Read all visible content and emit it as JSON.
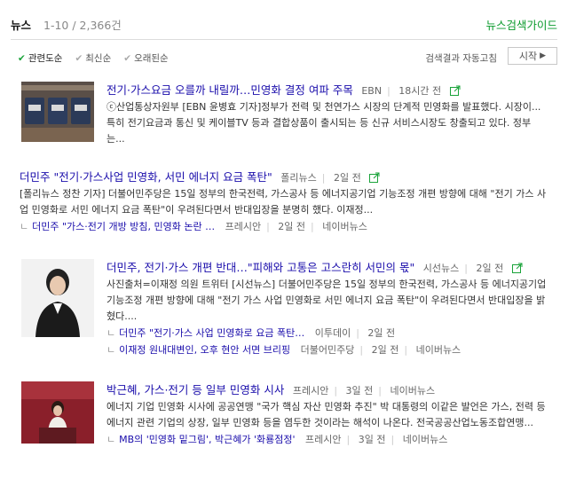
{
  "header": {
    "title": "뉴스",
    "count": "1-10 / 2,366건",
    "guide_link": "뉴스검색가이드"
  },
  "sort": {
    "options": [
      "관련도순",
      "최신순",
      "오래된순"
    ],
    "selected": "관련도순"
  },
  "autorefresh": {
    "label": "검색결과 자동고침",
    "button": "시작"
  },
  "results": [
    {
      "title": "전기·가스요금 오를까 내릴까…민영화 결정 여파 주목",
      "source": "EBN",
      "time": "18시간 전",
      "desc": "ⓒ산업통상자원부 [EBN 윤병효 기자]정부가 전력 및 천연가스 시장의 단계적 민영화를 발표했다. 시장이... 특히 전기요금과 통신 및 케이블TV 등과 결합상품이 출시되는 등 신규 서비스시장도 창출되고 있다. 정부는..."
    },
    {
      "title": "더민주 \"전기·가스사업 민영화, 서민 에너지 요금 폭탄\"",
      "source": "폴리뉴스",
      "time": "2일 전",
      "desc": "[폴리뉴스 정찬 기자] 더불어민주당은 15일 정부의 한국전력, 가스공사 등 에너지공기업 기능조정 개편 방향에 대해 \"전기 가스 사업 민영화로 서민 에너지 요금 폭탄\"이 우려된다면서 반대입장을 분명히 했다. 이재정...",
      "related": [
        {
          "title": "더민주 \"가스·전기 개방 방침, 민영화 논란 …",
          "source": "프레시안",
          "time": "2일 전",
          "portal": "네이버뉴스"
        }
      ]
    },
    {
      "title": "더민주, 전기·가스 개편 반대…\"피해와 고통은 고스란히 서민의 몫\"",
      "source": "시선뉴스",
      "time": "2일 전",
      "desc": "사진출처=이재정 의원 트위터 [시선뉴스] 더불어민주당은 15일 정부의 한국전력, 가스공사 등 에너지공기업 기능조정 개편 방향에 대해 \"전기 가스 사업 민영화로 서민 에너지 요금 폭탄\"이 우려된다면서 반대입장을 밝혔다....",
      "related": [
        {
          "title": "더민주 \"전기·가스 사업 민영화로 요금 폭탄…",
          "source": "이투데이",
          "time": "2일 전",
          "portal": ""
        },
        {
          "title": "이재정 원내대변인, 오후 현안 서면 브리핑",
          "source": "더불어민주당",
          "time": "2일 전",
          "portal": "네이버뉴스"
        }
      ]
    },
    {
      "title": "박근혜, 가스·전기 등 일부 민영화 시사",
      "source": "프레시안",
      "time": "3일 전",
      "portal": "네이버뉴스",
      "desc": "에너지 기업 민영화 시사에 공공연맹 \"국가 핵심 자산 민영화 추진\" 박 대통령의 이같은 발언은 가스, 전력 등 에너지 관련 기업의 상장, 일부 민영화 등을 염두한 것이라는 해석이 나온다. 전국공공산업노동조합연맹...",
      "related": [
        {
          "title": "MB의 '민영화 밑그림', 박근혜가 '화룡점정'",
          "source": "프레시안",
          "time": "3일 전",
          "portal": "네이버뉴스"
        }
      ]
    }
  ],
  "colors": {
    "accent": "#0a9a2c",
    "link": "#1a0dab"
  }
}
